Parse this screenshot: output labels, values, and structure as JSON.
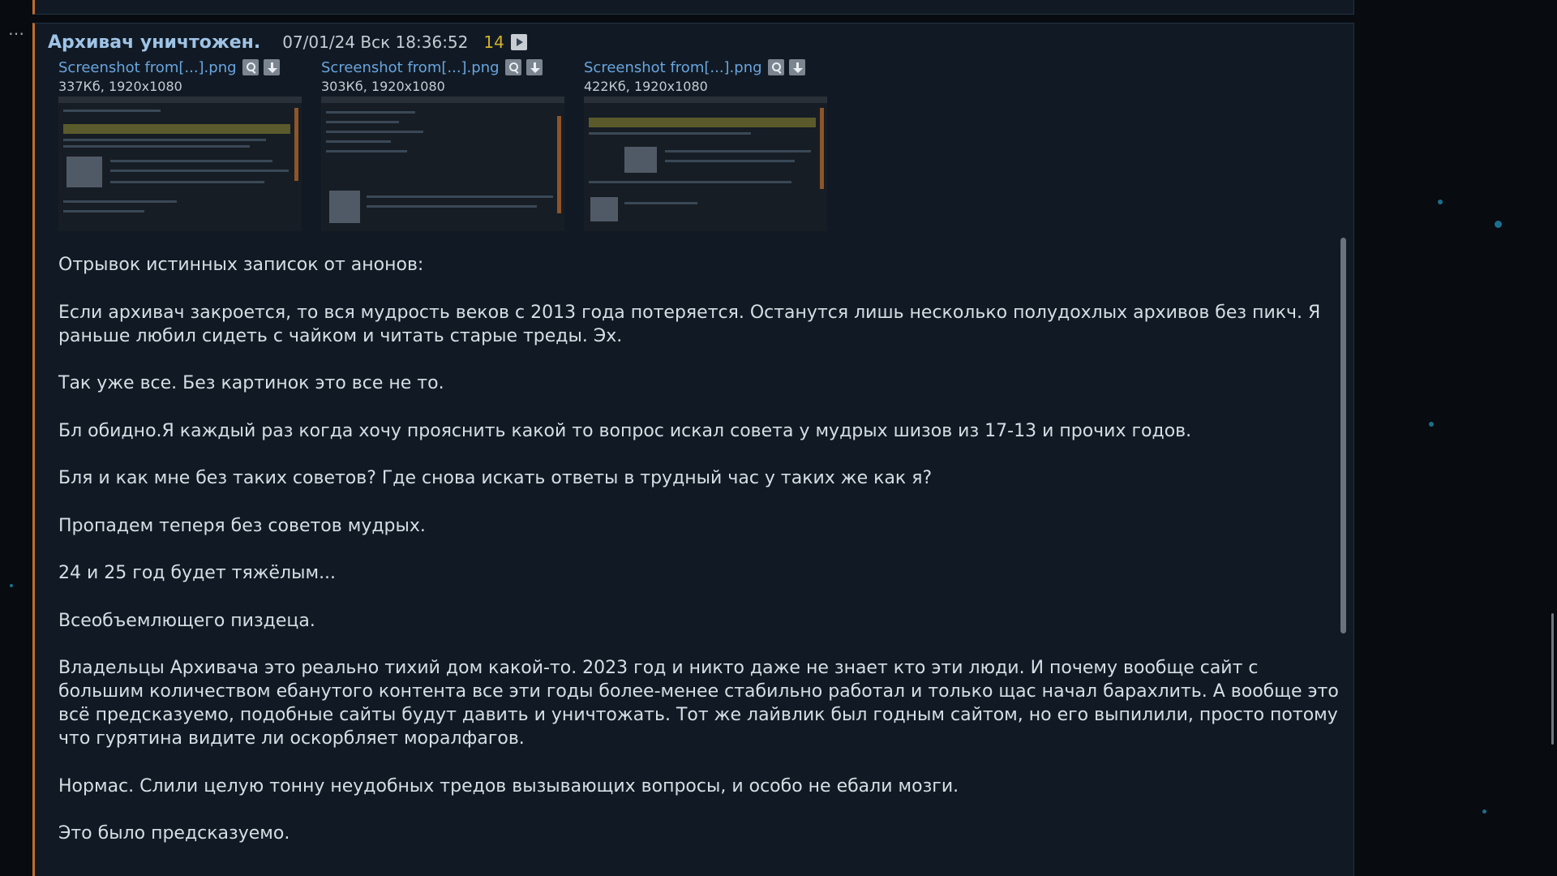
{
  "sidebar": {
    "more_label": "…"
  },
  "post": {
    "subject": "Архивач уничтожен.",
    "datetime": "07/01/24 Вск 18:36:52",
    "number": "14",
    "files": [
      {
        "name": "Screenshot from[...].png",
        "meta": "337Кб, 1920x1080"
      },
      {
        "name": "Screenshot from[...].png",
        "meta": "303Кб, 1920x1080"
      },
      {
        "name": "Screenshot from[...].png",
        "meta": "422Кб, 1920x1080"
      }
    ],
    "paragraphs": [
      "Отрывок истинных записок от анонов:",
      "Если архивач закроется, то вся мудрость веков с 2013 года потеряется. Останутся лишь несколько полудохлых архивов без пикч. Я раньше любил сидеть с чайком и читать старые треды. Эх.",
      "Так уже все. Без картинок это все не то.",
      "Бл обидно.Я каждый раз когда хочу прояснить какой то вопрос искал совета у мудрых шизов из 17-13 и прочих годов.",
      "Бля и как мне без таких советов? Где снова искать ответы в трудный час у таких же как я?",
      "Пропадем теперя без советов мудрых.",
      "24 и 25 год будет тяжёлым...",
      "Всеобъемлющего пиздеца.",
      "Владельцы Архивача это реально тихий дом какой-то. 2023 год и никто даже не знает кто эти люди. И почему вообще сайт с большим количеством ебанутого контента все эти годы более-менее стабильно работал и только щас начал барахлить. А вообще это всё предсказуемо, подобные сайты будут давить и уничтожать. Тот же лайвлик был годным сайтом, но его выпилили, просто потому что гурятина видите ли оскорбляет моралфагов.",
      "Нормас. Слили целую тонну неудобных тредов вызывающих вопросы, и особо не ебали мозги.",
      "Это было предсказуемо."
    ]
  },
  "colors": {
    "accent": "#c06d2c",
    "subject": "#9fc3e6",
    "post_number": "#d2b12c",
    "link": "#6aa5de"
  },
  "icons": {
    "play": "play-icon",
    "search": "search-icon",
    "download": "download-icon"
  }
}
